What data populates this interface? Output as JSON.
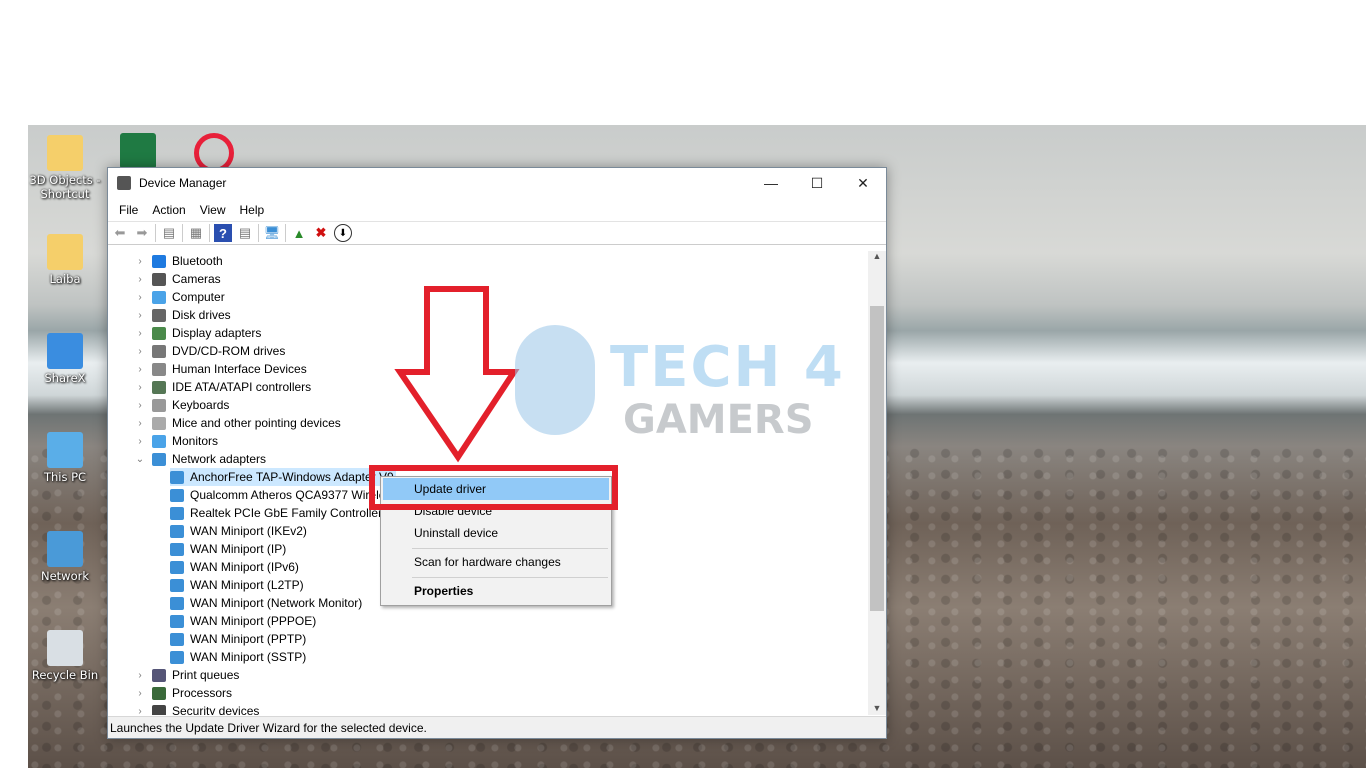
{
  "desktop": {
    "icons": [
      {
        "label": "3D Objects - Shortcut",
        "icon": "folder-3d-icon",
        "color": "#f5cf6a"
      },
      {
        "label": "Laiba",
        "icon": "user-folder-icon",
        "color": "#f5cf6a"
      },
      {
        "label": "ShareX",
        "icon": "sharex-icon",
        "color": "#3a8de0"
      },
      {
        "label": "This PC",
        "icon": "computer-icon",
        "color": "#5aaee8"
      },
      {
        "label": "Network",
        "icon": "network-icon",
        "color": "#4a9ad8"
      },
      {
        "label": "Recycle Bin",
        "icon": "recycle-bin-icon",
        "color": "#d9dfe4"
      }
    ]
  },
  "window": {
    "title": "Device Manager",
    "menu": [
      "File",
      "Action",
      "View",
      "Help"
    ],
    "tree": [
      {
        "label": "Bluetooth",
        "level": 0,
        "icon": "bluetooth-icon",
        "color": "#1e7ae0"
      },
      {
        "label": "Cameras",
        "level": 0,
        "icon": "camera-icon",
        "color": "#555"
      },
      {
        "label": "Computer",
        "level": 0,
        "icon": "computer-icon",
        "color": "#4aa3e8"
      },
      {
        "label": "Disk drives",
        "level": 0,
        "icon": "disk-icon",
        "color": "#666"
      },
      {
        "label": "Display adapters",
        "level": 0,
        "icon": "display-adapter-icon",
        "color": "#4a8a4a"
      },
      {
        "label": "DVD/CD-ROM drives",
        "level": 0,
        "icon": "dvd-icon",
        "color": "#777"
      },
      {
        "label": "Human Interface Devices",
        "level": 0,
        "icon": "hid-icon",
        "color": "#888"
      },
      {
        "label": "IDE ATA/ATAPI controllers",
        "level": 0,
        "icon": "ide-icon",
        "color": "#557755"
      },
      {
        "label": "Keyboards",
        "level": 0,
        "icon": "keyboard-icon",
        "color": "#999"
      },
      {
        "label": "Mice and other pointing devices",
        "level": 0,
        "icon": "mouse-icon",
        "color": "#aaa"
      },
      {
        "label": "Monitors",
        "level": 0,
        "icon": "monitor-icon",
        "color": "#4aa3e8"
      },
      {
        "label": "Network adapters",
        "level": 0,
        "expanded": true,
        "icon": "network-adapter-icon",
        "color": "#3b8fd6"
      },
      {
        "label": "AnchorFree TAP-Windows Adapter V9",
        "level": 1,
        "selected": true,
        "icon": "network-adapter-icon",
        "color": "#3b8fd6"
      },
      {
        "label": "Qualcomm Atheros QCA9377 Wireless Network Adapter",
        "level": 1,
        "icon": "network-adapter-icon",
        "color": "#3b8fd6"
      },
      {
        "label": "Realtek PCIe GbE Family Controller",
        "level": 1,
        "icon": "network-adapter-icon",
        "color": "#3b8fd6"
      },
      {
        "label": "WAN Miniport (IKEv2)",
        "level": 1,
        "icon": "network-adapter-icon",
        "color": "#3b8fd6"
      },
      {
        "label": "WAN Miniport (IP)",
        "level": 1,
        "icon": "network-adapter-icon",
        "color": "#3b8fd6"
      },
      {
        "label": "WAN Miniport (IPv6)",
        "level": 1,
        "icon": "network-adapter-icon",
        "color": "#3b8fd6"
      },
      {
        "label": "WAN Miniport (L2TP)",
        "level": 1,
        "icon": "network-adapter-icon",
        "color": "#3b8fd6"
      },
      {
        "label": "WAN Miniport (Network Monitor)",
        "level": 1,
        "icon": "network-adapter-icon",
        "color": "#3b8fd6"
      },
      {
        "label": "WAN Miniport (PPPOE)",
        "level": 1,
        "icon": "network-adapter-icon",
        "color": "#3b8fd6"
      },
      {
        "label": "WAN Miniport (PPTP)",
        "level": 1,
        "icon": "network-adapter-icon",
        "color": "#3b8fd6"
      },
      {
        "label": "WAN Miniport (SSTP)",
        "level": 1,
        "icon": "network-adapter-icon",
        "color": "#3b8fd6"
      },
      {
        "label": "Print queues",
        "level": 0,
        "icon": "printer-icon",
        "color": "#557"
      },
      {
        "label": "Processors",
        "level": 0,
        "icon": "processor-icon",
        "color": "#3a6a3a"
      },
      {
        "label": "Security devices",
        "level": 0,
        "icon": "security-device-icon",
        "color": "#444"
      }
    ],
    "status": "Launches the Update Driver Wizard for the selected device."
  },
  "context_menu": {
    "items": [
      "Update driver",
      "Disable device",
      "Uninstall device",
      "Scan for hardware changes",
      "Properties"
    ]
  },
  "watermark": {
    "line1": "TECH 4",
    "line2": "GAMERS"
  },
  "colors": {
    "highlight": "#e3202b",
    "menu_hover": "#91c9f7"
  }
}
